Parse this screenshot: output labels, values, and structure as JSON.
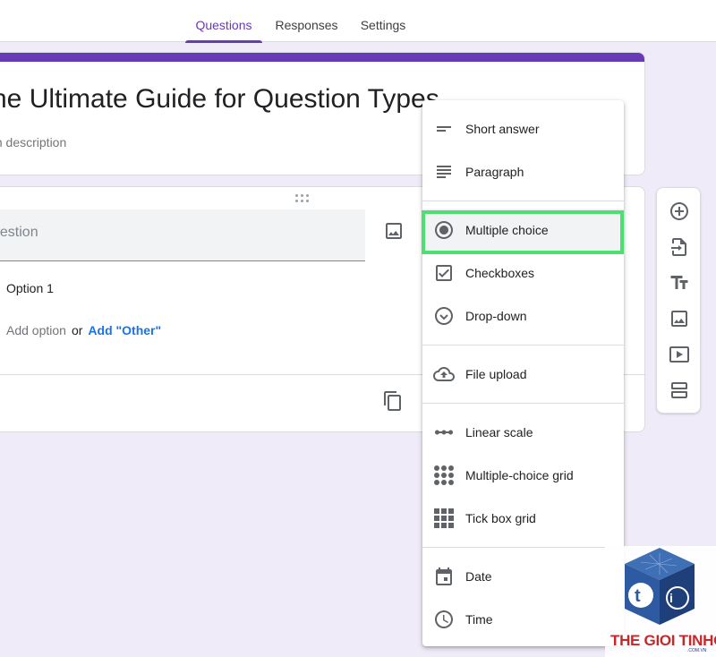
{
  "header": {
    "tabs": [
      {
        "label": "Questions",
        "active": true
      },
      {
        "label": "Responses",
        "active": false
      },
      {
        "label": "Settings",
        "active": false
      }
    ],
    "accent_color": "#673ab7"
  },
  "form": {
    "title": "he Ultimate Guide for Question Types",
    "description": "m description"
  },
  "question": {
    "placeholder": "uestion",
    "options": [
      "Option 1"
    ],
    "add_option_label": "Add option",
    "or_label": "or",
    "add_other_label": "Add \"Other\""
  },
  "toolbar": {
    "items": [
      {
        "icon": "add-circle-icon"
      },
      {
        "icon": "import-questions-icon"
      },
      {
        "icon": "title-text-icon"
      },
      {
        "icon": "image-icon"
      },
      {
        "icon": "video-icon"
      },
      {
        "icon": "section-icon"
      }
    ]
  },
  "menu": {
    "items": [
      {
        "label": "Short answer",
        "icon": "short-answer-icon"
      },
      {
        "label": "Paragraph",
        "icon": "paragraph-icon"
      },
      {
        "label": "Multiple choice",
        "icon": "radio-button-icon",
        "selected": true
      },
      {
        "label": "Checkboxes",
        "icon": "checkbox-icon"
      },
      {
        "label": "Drop-down",
        "icon": "dropdown-icon"
      },
      {
        "label": "File upload",
        "icon": "cloud-upload-icon"
      },
      {
        "label": "Linear scale",
        "icon": "linear-scale-icon"
      },
      {
        "label": "Multiple-choice grid",
        "icon": "dot-grid-icon"
      },
      {
        "label": "Tick box grid",
        "icon": "square-grid-icon"
      },
      {
        "label": "Date",
        "icon": "calendar-icon"
      },
      {
        "label": "Time",
        "icon": "clock-icon"
      }
    ],
    "highlight_color": "#4ddf6f"
  },
  "watermark": {
    "text": "THE GIOI TINHOC",
    "small_text": ".COM.VN"
  }
}
